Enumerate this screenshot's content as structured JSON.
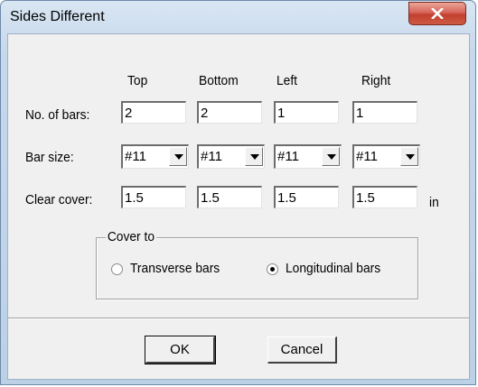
{
  "window": {
    "title": "Sides Different",
    "close_glyph": "X"
  },
  "columns": {
    "top": "Top",
    "bottom": "Bottom",
    "left": "Left",
    "right": "Right"
  },
  "rows": {
    "no_of_bars": {
      "label": "No. of bars:",
      "top": "2",
      "bottom": "2",
      "left": "1",
      "right": "1"
    },
    "bar_size": {
      "label": "Bar size:",
      "top": "#11",
      "bottom": "#11",
      "left": "#11",
      "right": "#11"
    },
    "clear_cover": {
      "label": "Clear cover:",
      "top": "1.5",
      "bottom": "1.5",
      "left": "1.5",
      "right": "1.5",
      "unit": "in"
    }
  },
  "cover_to": {
    "legend": "Cover to",
    "options": [
      {
        "label": "Transverse bars",
        "selected": false
      },
      {
        "label": "Longitudinal bars",
        "selected": true
      }
    ]
  },
  "buttons": {
    "ok": "OK",
    "cancel": "Cancel"
  },
  "icons": {
    "close": "close-icon",
    "dropdown": "chevron-down-icon"
  },
  "colors": {
    "close_button": "#c2402f",
    "dialog_background": "#f0f0f0",
    "title_gradient": "#c6d8ec"
  }
}
